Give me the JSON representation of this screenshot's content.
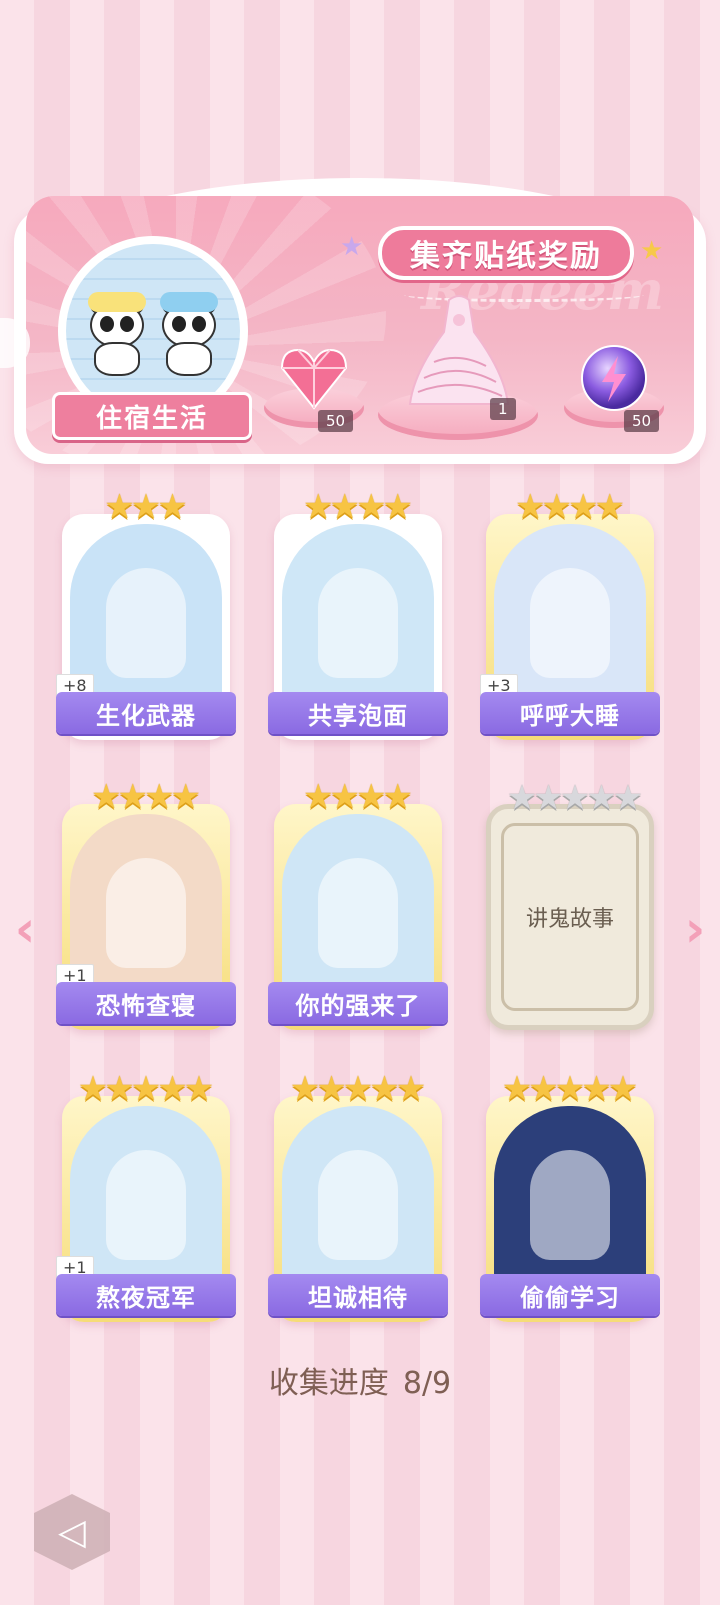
{
  "banner": {
    "title": "集齐贴纸奖励",
    "watermark": "Redeem",
    "theme_label": "住宿生活",
    "rewards": [
      {
        "icon": "pink-diamond-icon",
        "count": "50"
      },
      {
        "icon": "dress-icon",
        "count": "1"
      },
      {
        "icon": "energy-orb-icon",
        "count": "50"
      }
    ]
  },
  "cards": [
    {
      "title": "生化武器",
      "plus": "+8",
      "stars": 3,
      "total_stars": 3,
      "art_color": "#c9e3f7"
    },
    {
      "title": "共享泡面",
      "plus": "",
      "stars": 4,
      "total_stars": 4,
      "art_color": "#cfe7f7"
    },
    {
      "title": "呼呼大睡",
      "plus": "+3",
      "stars": 4,
      "total_stars": 4,
      "art_color": "#d9e6f8"
    },
    {
      "title": "恐怖查寝",
      "plus": "+1",
      "stars": 4,
      "total_stars": 4,
      "art_color": "#f3dac7"
    },
    {
      "title": "你的强来了",
      "plus": "",
      "stars": 4,
      "total_stars": 4,
      "art_color": "#cfe6f6"
    },
    {
      "title": "讲鬼故事",
      "plus": "",
      "stars": 0,
      "total_stars": 5,
      "locked": true
    },
    {
      "title": "熬夜冠军",
      "plus": "+1",
      "stars": 5,
      "total_stars": 5,
      "art_color": "#cfe6f6"
    },
    {
      "title": "坦诚相待",
      "plus": "",
      "stars": 5,
      "total_stars": 5,
      "art_color": "#cfe6f6"
    },
    {
      "title": "偷偷学习",
      "plus": "",
      "stars": 5,
      "total_stars": 5,
      "art_color": "#2c3f7a"
    }
  ],
  "progress": {
    "label": "收集进度",
    "value": "8/9"
  },
  "nav": {
    "prev": "‹",
    "next": "›",
    "back_icon": "back-icon"
  }
}
